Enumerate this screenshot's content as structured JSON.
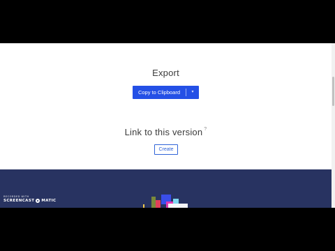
{
  "export": {
    "title": "Export",
    "copy_button_label": "Copy to Clipboard",
    "dropdown_icon": "chevron-down-icon"
  },
  "link_version": {
    "title": "Link to this version",
    "help_icon": "help-icon",
    "help_glyph": "?",
    "create_button_label": "Create"
  },
  "watermark": {
    "recorded_with": "RECORDED WITH",
    "brand_left": "SCREENCAST",
    "brand_right": "MATIC"
  },
  "colors": {
    "primary_button": "#2450e6",
    "create_outline": "#2f63d8",
    "footer_background": "#283361",
    "cursor_highlight": "#ffec5a"
  }
}
